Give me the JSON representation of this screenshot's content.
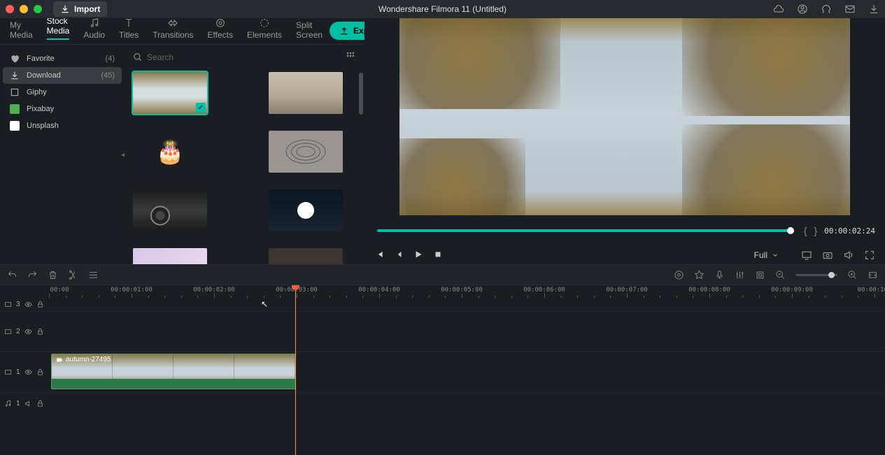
{
  "titlebar": {
    "import_label": "Import",
    "app_title": "Wondershare Filmora 11 (Untitled)"
  },
  "tabs": {
    "items": [
      {
        "id": "my-media",
        "label": "My Media"
      },
      {
        "id": "stock-media",
        "label": "Stock Media"
      },
      {
        "id": "audio",
        "label": "Audio"
      },
      {
        "id": "titles",
        "label": "Titles"
      },
      {
        "id": "transitions",
        "label": "Transitions"
      },
      {
        "id": "effects",
        "label": "Effects"
      },
      {
        "id": "elements",
        "label": "Elements"
      },
      {
        "id": "split-screen",
        "label": "Split Screen"
      }
    ],
    "active": "stock-media",
    "export_label": "Export"
  },
  "sidebar": {
    "items": [
      {
        "id": "favorite",
        "label": "Favorite",
        "count": "(4)",
        "icon": "heart"
      },
      {
        "id": "download",
        "label": "Download",
        "count": "(45)",
        "icon": "download",
        "selected": true
      },
      {
        "id": "giphy",
        "label": "Giphy",
        "icon": "giphy"
      },
      {
        "id": "pixabay",
        "label": "Pixabay",
        "icon": "pixabay"
      },
      {
        "id": "unsplash",
        "label": "Unsplash",
        "icon": "unsplash"
      }
    ]
  },
  "search": {
    "placeholder": "Search"
  },
  "preview": {
    "timecode": "00:00:02:24",
    "quality_label": "Full"
  },
  "ruler": {
    "labels": [
      "00:00",
      "00:00:01:00",
      "00:00:02:00",
      "00:00:03:00",
      "00:00:04:00",
      "00:00:05:00",
      "00:00:06:00",
      "00:00:07:00",
      "00:00:08:00",
      "00:00:09:00",
      "00:00:10:"
    ]
  },
  "tracks": {
    "v3": "3",
    "v2": "2",
    "v1": "1",
    "a1": "1"
  },
  "clip": {
    "name": "autumn-27495"
  }
}
